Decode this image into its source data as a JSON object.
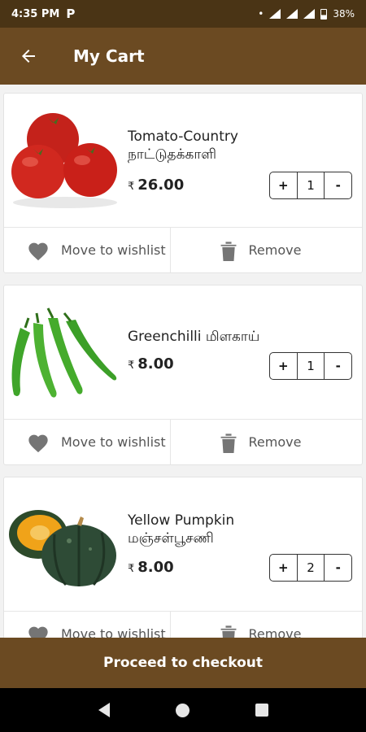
{
  "status_bar": {
    "time": "4:35 PM",
    "app_icon": "P",
    "battery": "38%"
  },
  "header": {
    "title": "My Cart",
    "back_icon": "arrow-left-icon"
  },
  "cart": {
    "items": [
      {
        "name": "Tomato-Country",
        "tamil_name": "நாட்டுதக்காளி",
        "currency": "₹",
        "price": "26.00",
        "quantity": "1",
        "image": "tomato-image"
      },
      {
        "name": "Greenchilli மிளகாய்",
        "tamil_name": "",
        "currency": "₹",
        "price": "8.00",
        "quantity": "1",
        "image": "green-chilli-image"
      },
      {
        "name": "Yellow Pumpkin",
        "tamil_name": "மஞ்சள்பூசணி",
        "currency": "₹",
        "price": "8.00",
        "quantity": "2",
        "image": "pumpkin-image"
      }
    ],
    "plus_label": "+",
    "minus_label": "-",
    "wishlist_label": "Move to wishlist",
    "remove_label": "Remove"
  },
  "footer": {
    "checkout_label": "Proceed to checkout"
  },
  "colors": {
    "header_bg": "#6b4a22",
    "status_bg": "#4a3415",
    "icon_grey": "#757575"
  }
}
